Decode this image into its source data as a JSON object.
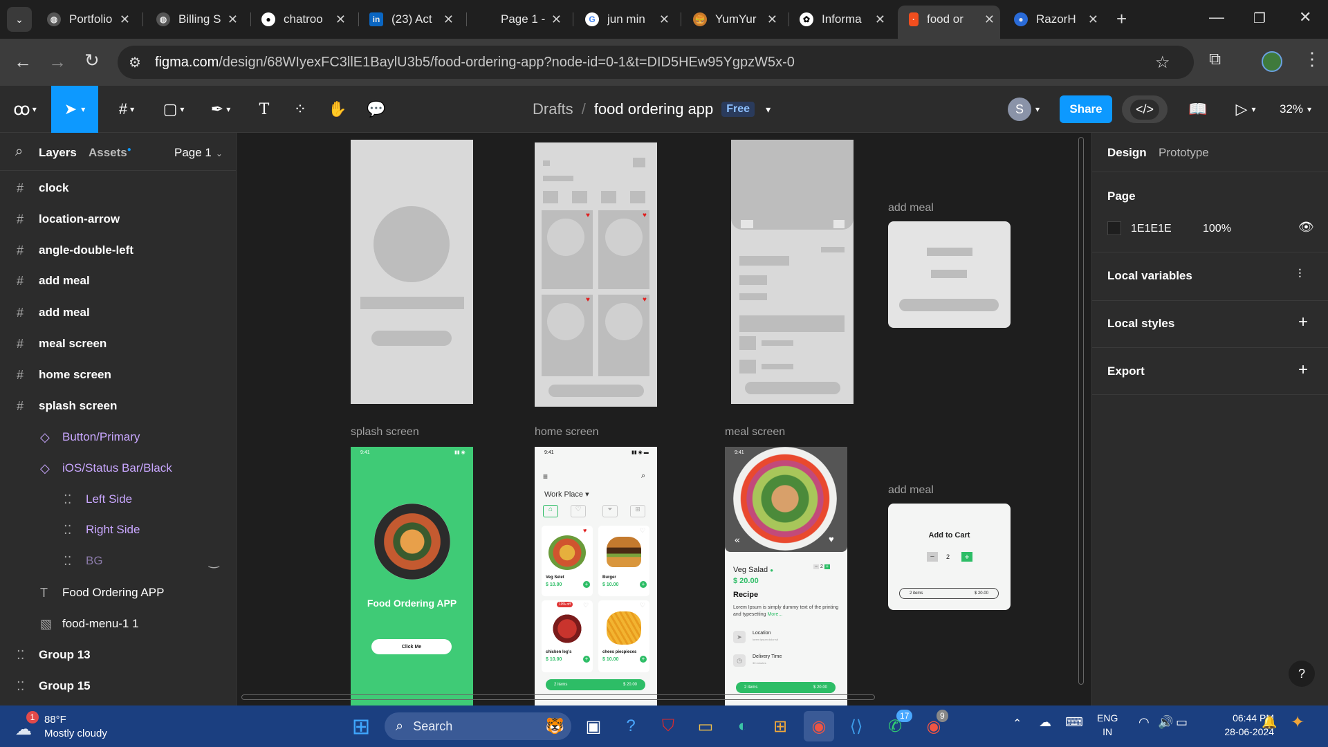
{
  "browser": {
    "tabs": [
      {
        "title": "Portfolio",
        "icon": "globe-icon"
      },
      {
        "title": "Billing S",
        "icon": "globe-icon"
      },
      {
        "title": "chatroo",
        "icon": "github-icon"
      },
      {
        "title": "(23) Act",
        "icon": "linkedin-icon"
      },
      {
        "title": "Page 1 -",
        "icon": "blank-icon"
      },
      {
        "title": "jun min",
        "icon": "google-icon"
      },
      {
        "title": "YumYur",
        "icon": "burger-icon"
      },
      {
        "title": "Informa",
        "icon": "openai-icon"
      },
      {
        "title": "food or",
        "icon": "figma-icon"
      },
      {
        "title": "RazorH",
        "icon": "chrome-icon"
      }
    ],
    "url_host": "figma.com",
    "url_path": "/design/68WIyexFC3llE1BaylU3b5/food-ordering-app?node-id=0-1&t=DID5HEw95YgpzW5x-0"
  },
  "figma": {
    "breadcrumb_root": "Drafts",
    "breadcrumb_sep": "/",
    "file_name": "food ordering app",
    "plan_badge": "Free",
    "avatar_letter": "S",
    "share_label": "Share",
    "zoom": "32%"
  },
  "left_panel": {
    "tab_layers": "Layers",
    "tab_assets": "Assets",
    "page_selector": "Page 1",
    "layers": [
      {
        "name": "clock",
        "type": "frame"
      },
      {
        "name": "location-arrow",
        "type": "frame"
      },
      {
        "name": "angle-double-left",
        "type": "frame"
      },
      {
        "name": "add meal",
        "type": "frame"
      },
      {
        "name": "add meal",
        "type": "frame"
      },
      {
        "name": "meal screen",
        "type": "frame"
      },
      {
        "name": "home screen",
        "type": "frame"
      },
      {
        "name": "splash screen",
        "type": "frame"
      },
      {
        "name": "Button/Primary",
        "type": "component"
      },
      {
        "name": "iOS/Status Bar/Black",
        "type": "component"
      },
      {
        "name": "Left Side",
        "type": "group"
      },
      {
        "name": "Right Side",
        "type": "group"
      },
      {
        "name": "BG",
        "type": "group-hidden"
      },
      {
        "name": "Food Ordering APP",
        "type": "text"
      },
      {
        "name": "food-menu-1 1",
        "type": "image"
      },
      {
        "name": "Group 13",
        "type": "group"
      },
      {
        "name": "Group 15",
        "type": "group"
      }
    ]
  },
  "right_panel": {
    "tab_design": "Design",
    "tab_prototype": "Prototype",
    "page_heading": "Page",
    "page_color": "1E1E1E",
    "page_opacity": "100%",
    "local_variables": "Local variables",
    "local_styles": "Local styles",
    "export": "Export",
    "help": "?"
  },
  "canvas": {
    "labels": {
      "add_meal_1": "add meal",
      "add_meal_2": "add meal",
      "splash": "splash screen",
      "home": "home screen",
      "meal": "meal screen"
    },
    "splash": {
      "time": "9:41",
      "title": "Food Ordering APP",
      "button": "Click Me",
      "bg_color": "#3fcb76"
    },
    "home": {
      "time": "9:41",
      "location": "Work Place",
      "items": [
        {
          "name": "Veg Selet",
          "price": "$ 10.00"
        },
        {
          "name": "Burger",
          "price": "$ 10.00"
        },
        {
          "name": "chicken leg's",
          "price": "$ 10.00",
          "badge": "10% off"
        },
        {
          "name": "chees piecpieces",
          "price": "$ 10.00"
        }
      ],
      "cart_items": "2 items",
      "cart_total": "$ 20.00"
    },
    "meal": {
      "time": "9:41",
      "title": "Veg Salad",
      "price": "$ 20.00",
      "qty": "2",
      "recipe_heading": "Recipe",
      "recipe_text": "Lorem Ipsum is simply dummy text of the printing and typesetting",
      "more": "More...",
      "location_label": "Location",
      "location_sub": "lorem ipsum dolor sit",
      "delivery_label": "Delivery Time",
      "delivery_sub": "30 minutes",
      "cart_items": "2 items",
      "cart_total": "$ 20.00"
    },
    "add_meal_card": {
      "title": "Add to Cart",
      "qty": "2",
      "items": "2 items",
      "total": "$ 20.00"
    }
  },
  "taskbar": {
    "weather_temp": "88°F",
    "weather_desc": "Mostly cloudy",
    "weather_badge": "1",
    "search_label": "Search",
    "whatsapp_badge": "17",
    "chrome_badge": "9",
    "lang_1": "ENG",
    "lang_2": "IN",
    "time": "06:44 PM",
    "date": "28-06-2024"
  },
  "colors": {
    "figma_blue": "#0d99ff",
    "selected_tool": "#0d99ff",
    "splash_green": "#3fcb76",
    "price_green": "#2dbd66"
  }
}
